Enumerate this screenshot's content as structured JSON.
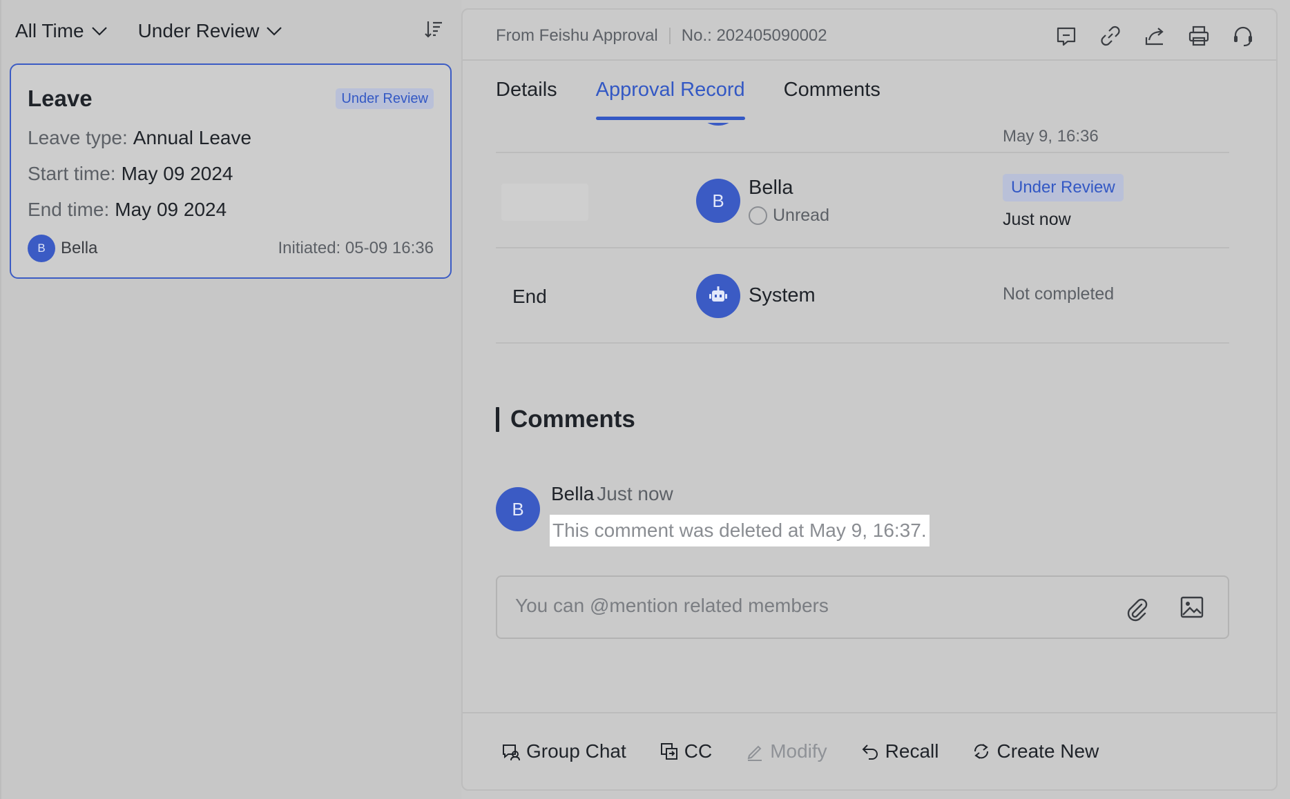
{
  "filters": {
    "time": "All Time",
    "status": "Under Review"
  },
  "card": {
    "title": "Leave",
    "badge": "Under Review",
    "leave_type_label": "Leave type:",
    "leave_type_value": "Annual Leave",
    "start_label": "Start time:",
    "start_value": "May 09 2024",
    "end_label": "End time:",
    "end_value": "May 09 2024",
    "avatar_initial": "B",
    "user": "Bella",
    "initiated": "Initiated: 05-09 16:36"
  },
  "header": {
    "source": "From Feishu Approval",
    "number": "No.: 202405090002"
  },
  "tabs": [
    {
      "label": "Details"
    },
    {
      "label": "Approval Record"
    },
    {
      "label": "Comments"
    }
  ],
  "record": {
    "row0_time": "May 9, 16:36",
    "row1": {
      "avatar_initial": "B",
      "name": "Bella",
      "read_state": "Unread",
      "status": "Under Review",
      "time": "Just now"
    },
    "row2": {
      "node": "End",
      "name": "System",
      "status": "Not completed"
    }
  },
  "comments": {
    "heading": "Comments",
    "items": [
      {
        "avatar_initial": "B",
        "name": "Bella",
        "time": "Just now",
        "text": "This comment was deleted at May 9, 16:37."
      }
    ],
    "input_placeholder": "You can @mention related members"
  },
  "actions": {
    "group_chat": "Group Chat",
    "cc": "CC",
    "modify": "Modify",
    "recall": "Recall",
    "create_new": "Create New"
  },
  "colors": {
    "accent": "#3358c4",
    "avatar": "#3b5bc4",
    "badge_bg": "#b9c0d8"
  }
}
